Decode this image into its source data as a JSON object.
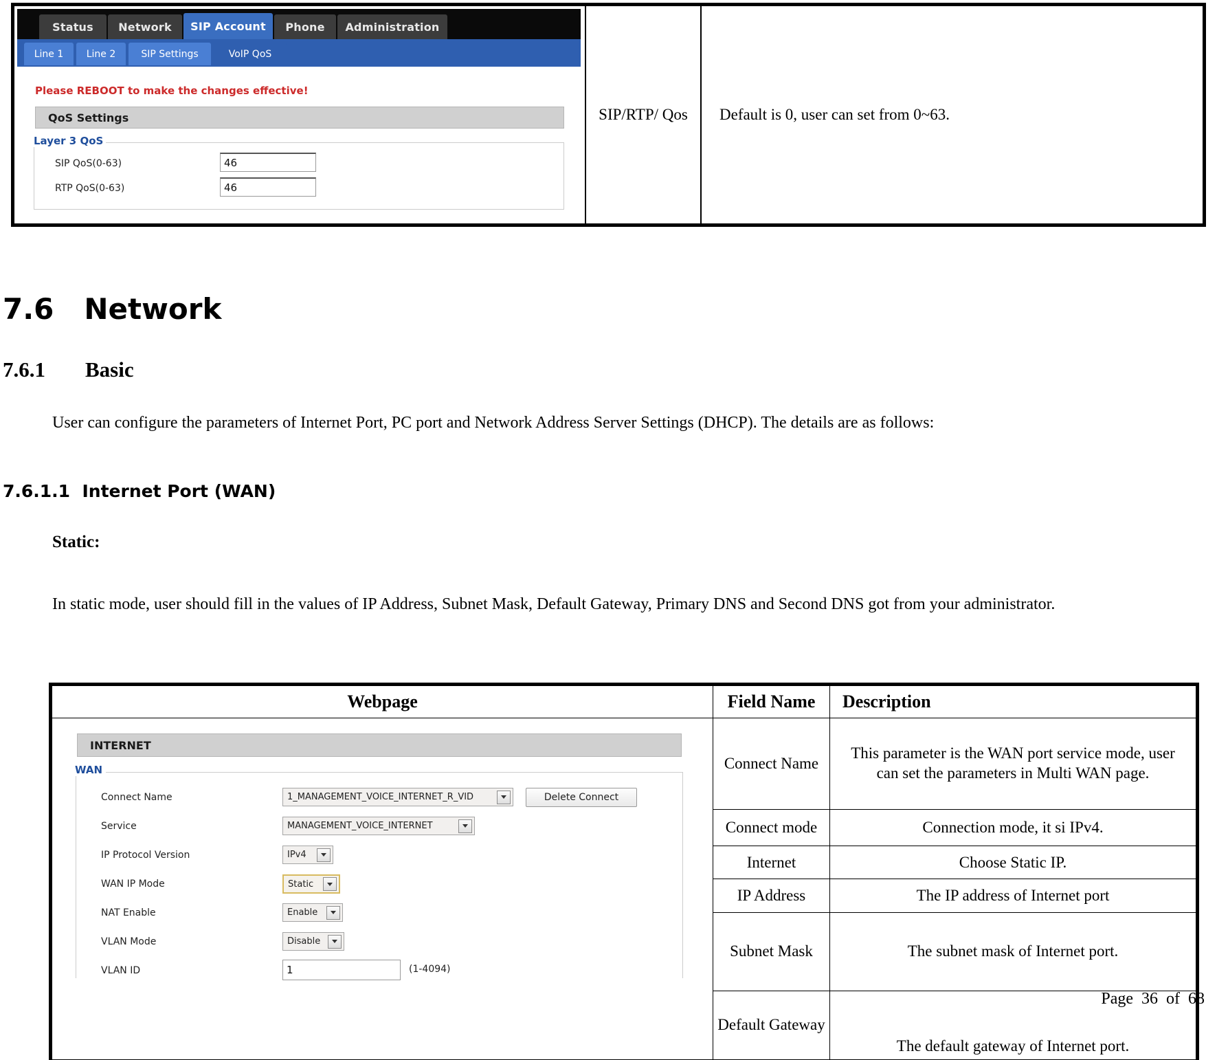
{
  "top_table": {
    "field_name": "SIP/RTP/ Qos",
    "description": "Default is 0, user can set from 0~63.",
    "router_ui": {
      "nav_tabs": [
        {
          "label": "Status",
          "active": false
        },
        {
          "label": "Network",
          "active": false
        },
        {
          "label": "SIP Account",
          "active": true
        },
        {
          "label": "Phone",
          "active": false
        },
        {
          "label": "Administration",
          "active": false
        }
      ],
      "sub_tabs": [
        {
          "label": "Line 1",
          "active": false
        },
        {
          "label": "Line 2",
          "active": false
        },
        {
          "label": "SIP Settings",
          "active": false
        },
        {
          "label": "VoIP QoS",
          "active": true
        }
      ],
      "reboot_message": "Please REBOOT to make the changes effective!",
      "section_title": "QoS Settings",
      "group_title": "Layer 3 QoS",
      "fields": [
        {
          "label": "SIP QoS(0-63)",
          "value": "46"
        },
        {
          "label": "RTP QoS(0-63)",
          "value": "46"
        }
      ]
    }
  },
  "headings": {
    "h2_number": "7.6",
    "h2_title": "Network",
    "h3_number": "7.6.1",
    "h3_title": "Basic",
    "h4": "7.6.1.1  Internet Port (WAN)"
  },
  "body": {
    "intro": "User can configure the parameters of Internet Port, PC port and Network Address Server Settings (DHCP). The details are as follows:",
    "static_lead": "Static:",
    "static_paragraph": "In static mode, user should fill in the values of IP Address, Subnet Mask, Default Gateway, Primary DNS and Second DNS got from your administrator."
  },
  "bottom_table": {
    "headers": {
      "webpage": "Webpage",
      "field_name": "Field Name",
      "description": "Description"
    },
    "rows": [
      {
        "field": "Connect Name",
        "desc": "This parameter is the WAN port service mode, user can set the parameters in Multi WAN page."
      },
      {
        "field": "Connect mode",
        "desc": "Connection mode, it si IPv4."
      },
      {
        "field": "Internet",
        "desc": "Choose Static IP."
      },
      {
        "field": "IP Address",
        "desc": "The IP address of Internet port"
      },
      {
        "field": "Subnet Mask",
        "desc": "The subnet mask of Internet port."
      },
      {
        "field": "Default Gateway",
        "desc": "The default gateway of Internet port."
      }
    ],
    "router_ui": {
      "section_title": "INTERNET",
      "group_title": "WAN",
      "delete_button": "Delete Connect",
      "vlan_hint": "(1-4094)",
      "fields": [
        {
          "label": "Connect Name",
          "type": "select",
          "value": "1_MANAGEMENT_VOICE_INTERNET_R_VID"
        },
        {
          "label": "Service",
          "type": "select",
          "value": "MANAGEMENT_VOICE_INTERNET"
        },
        {
          "label": "IP Protocol Version",
          "type": "select",
          "value": "IPv4"
        },
        {
          "label": "WAN IP Mode",
          "type": "select",
          "value": "Static"
        },
        {
          "label": "NAT Enable",
          "type": "select",
          "value": "Enable"
        },
        {
          "label": "VLAN Mode",
          "type": "select",
          "value": "Disable"
        },
        {
          "label": "VLAN ID",
          "type": "text",
          "value": "1"
        }
      ]
    }
  },
  "footer": {
    "page_label": "Page  36  of  68"
  },
  "colors": {
    "nav_bg": "#0a0a0a",
    "nav_tab": "#3c3c3c",
    "nav_tab_active": "#3a6ec0",
    "sub_bar": "#2f5fb0",
    "sub_tab": "#4a7fd4",
    "section_bar": "#d0d0d0",
    "group_label": "#1f4e9c",
    "warning_red": "#cc2a2a",
    "focus_outline": "#d8bb60"
  }
}
